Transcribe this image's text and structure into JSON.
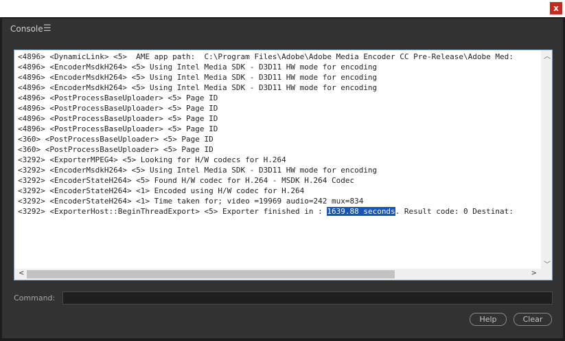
{
  "window": {
    "close_glyph": "x"
  },
  "panel": {
    "title": "Console",
    "menu_icon": "hamburger-menu-icon",
    "menu_glyph": "☰"
  },
  "console": {
    "lines": [
      "<4896> <DynamicLink> <5>  AME app path:  C:\\Program Files\\Adobe\\Adobe Media Encoder CC Pre-Release\\Adobe Med:",
      "<4896> <EncoderMsdkH264> <5> Using Intel Media SDK - D3D11 HW mode for encoding",
      "<4896> <EncoderMsdkH264> <5> Using Intel Media SDK - D3D11 HW mode for encoding",
      "<4896> <EncoderMsdkH264> <5> Using Intel Media SDK - D3D11 HW mode for encoding",
      "<4896> <PostProcessBaseUploader> <5> Page ID",
      "<4896> <PostProcessBaseUploader> <5> Page ID",
      "<4896> <PostProcessBaseUploader> <5> Page ID",
      "<4896> <PostProcessBaseUploader> <5> Page ID",
      "<360> <PostProcessBaseUploader> <5> Page ID",
      "<360> <PostProcessBaseUploader> <5> Page ID",
      "<3292> <ExporterMPEG4> <5> Looking for H/W codecs for H.264",
      "<3292> <EncoderMsdkH264> <5> Using Intel Media SDK - D3D11 HW mode for encoding",
      "<3292> <EncoderStateH264> <5> Found H/W codec for H.264 - MSDK H.264 Codec",
      "<3292> <EncoderStateH264> <1> Encoded using H/W codec for H.264",
      "<3292> <EncoderStateH264> <1> Time taken for; video =19969 audio=242 mux=834"
    ],
    "last_line": {
      "prefix": "<3292> <ExporterHost::BeginThreadExport> <5> Exporter finished in : ",
      "highlight": "1639.88 seconds",
      "suffix": ". Result code: 0 Destinat:"
    },
    "scroll_up_glyph": "︿",
    "scroll_down_glyph": "﹀",
    "scroll_left_glyph": "<",
    "scroll_right_glyph": ">"
  },
  "command": {
    "label": "Command:",
    "value": ""
  },
  "buttons": {
    "help": "Help",
    "clear": "Clear"
  }
}
